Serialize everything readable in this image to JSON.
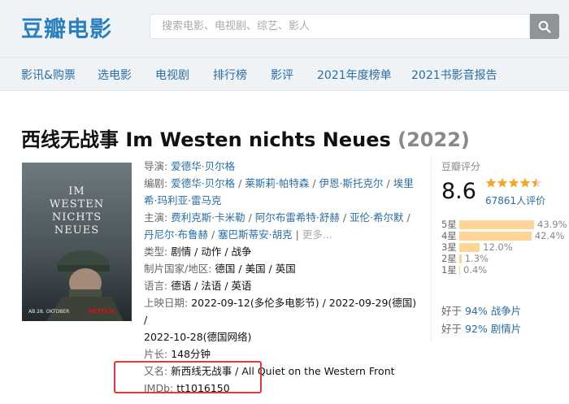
{
  "header": {
    "logo": "豆瓣电影",
    "search_placeholder": "搜索电影、电视剧、综艺、影人"
  },
  "nav": [
    "影讯&购票",
    "选电影",
    "电视剧",
    "排行榜",
    "影评",
    "2021年度榜单",
    "2021书影音报告"
  ],
  "movie": {
    "title": "西线无战事 Im Westen nichts Neues",
    "year": "(2022)",
    "poster": {
      "title_lines": [
        "IM",
        "WESTEN",
        "NICHTS",
        "NEUES"
      ],
      "date": "AB 28. OKTOBER",
      "brand": "NETFLIX"
    },
    "labels": {
      "director": "导演",
      "writer": "编剧",
      "cast": "主演",
      "genre": "类型:",
      "country": "制片国家/地区:",
      "language": "语言:",
      "release": "上映日期:",
      "runtime": "片长:",
      "aka": "又名:",
      "imdb": "IMDb:"
    },
    "director": [
      "爱德华·贝尔格"
    ],
    "writers": [
      "爱德华·贝尔格",
      "莱斯莉·帕特森",
      "伊恩·斯托克尔",
      "埃里希·玛利亚·雷马克"
    ],
    "cast": [
      "费利克斯·卡米勒",
      "阿尔布雷希特·舒赫",
      "亚伦·希尔默",
      "丹尼尔·布鲁赫",
      "塞巴斯蒂安·胡克"
    ],
    "cast_more": "更多...",
    "genre": "剧情 / 动作 / 战争",
    "country": "德国 / 美国 / 英国",
    "language": "德语 / 法语 / 英语",
    "release_line1": "2022-09-12(多伦多电影节) / 2022-09-29(德国) /",
    "release_line2": "2022-10-28(德国网络)",
    "runtime": "148分钟",
    "aka": "新西线无战事 / All Quiet on the Western Front",
    "imdb": "tt1016150"
  },
  "rating": {
    "label": "豆瓣评分",
    "score": "8.6",
    "stars": 4.5,
    "votes": "67861人评价",
    "distribution": [
      {
        "label": "5星",
        "pct": "43.9%",
        "value": 43.9
      },
      {
        "label": "4星",
        "pct": "42.4%",
        "value": 42.4
      },
      {
        "label": "3星",
        "pct": "12.0%",
        "value": 12.0
      },
      {
        "label": "2星",
        "pct": "1.3%",
        "value": 1.3
      },
      {
        "label": "1星",
        "pct": "0.4%",
        "value": 0.4
      }
    ],
    "better_than": [
      {
        "prefix": "好于",
        "pct": "94%",
        "genre": "战争片"
      },
      {
        "prefix": "好于",
        "pct": "92%",
        "genre": "剧情片"
      }
    ]
  },
  "colors": {
    "brand": "#2a7fc1",
    "link": "#2a6ea7",
    "star": "#f5a623",
    "bar": "#ffd596",
    "highlight": "#e03a3a"
  }
}
